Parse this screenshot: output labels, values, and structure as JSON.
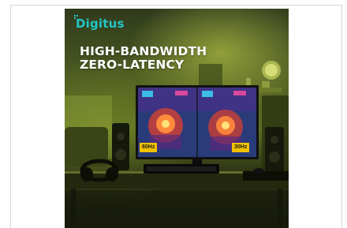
{
  "brand": {
    "name": "Digitus",
    "accent": "#21c6c6"
  },
  "headline": {
    "line1": "HIGH-BANDWIDTH",
    "line2": "ZERO-LATENCY"
  },
  "monitor": {
    "left_label": "60Hz",
    "right_label": "30Hz",
    "label_color": "#f2c200"
  }
}
